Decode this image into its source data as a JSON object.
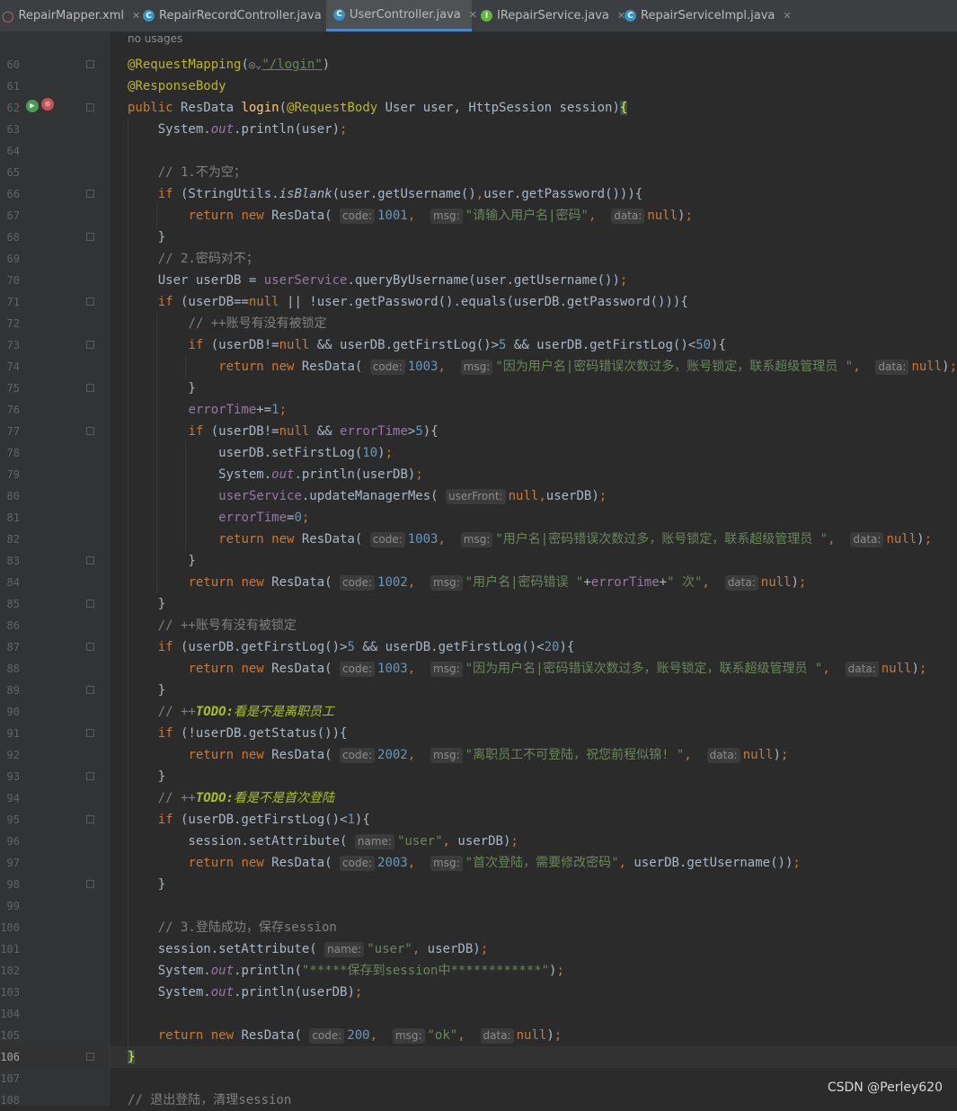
{
  "tabs": [
    {
      "label": "RepairMapper.xml",
      "icon": "xml-file-icon",
      "active": false
    },
    {
      "label": "RepairRecordController.java",
      "icon": "class-icon",
      "active": false
    },
    {
      "label": "UserController.java",
      "icon": "class-icon",
      "active": true
    },
    {
      "label": "IRepairService.java",
      "icon": "interface-icon",
      "active": false
    },
    {
      "label": "RepairServiceImpl.java",
      "icon": "class-icon",
      "active": false
    }
  ],
  "editor": {
    "usages_hint": "no usages",
    "current_line": 106,
    "line_numbers": [
      "60",
      "61",
      "62",
      "63",
      "64",
      "65",
      "66",
      "67",
      "68",
      "69",
      "70",
      "71",
      "72",
      "73",
      "74",
      "75",
      "76",
      "77",
      "78",
      "79",
      "80",
      "81",
      "82",
      "83",
      "84",
      "85",
      "86",
      "87",
      "88",
      "89",
      "90",
      "91",
      "92",
      "93",
      "94",
      "95",
      "96",
      "97",
      "98",
      "99",
      "100",
      "101",
      "102",
      "103",
      "104",
      "105",
      "106",
      "107",
      "108"
    ],
    "strings": {
      "login_path": "\"/login\"",
      "msg_empty": "\"请输入用户名|密码\"",
      "msg_locked_a": "\"因为用户名|密码错误次数过多，账号锁定，联系超级管理员 \"",
      "msg_locked_b": "\"用户名|密码错误次数过多，账号锁定，联系超级管理员 \"",
      "msg_wrong_a": "\"用户名|密码错误 \"",
      "msg_wrong_b": "\" 次\"",
      "msg_locked_c": "\"因为用户名|密码错误次数过多，账号锁定，联系超级管理员 \"",
      "msg_resigned": "\"离职员工不可登陆，祝您前程似锦! \"",
      "user_a": "\"user\"",
      "msg_first": "\"首次登陆，需要修改密码\"",
      "user_b": "\"user\"",
      "saved_session": "\"*****保存到session中************\"",
      "ok": "\"ok\""
    },
    "comments": {
      "c65": "// 1.不为空；",
      "c69": "// 2.密码对不；",
      "c72": "// ++账号有没有被锁定",
      "c86": "// ++账号有没有被锁定",
      "c90_prefix": "// ++",
      "c90_todo": "TODO:",
      "c90_text": "看是不是离职员工",
      "c94_prefix": "// ++",
      "c94_todo": "TODO:",
      "c94_text": "看是不是首次登陆",
      "c100": "// 3.登陆成功，保存session",
      "c108": "// 退出登陆，清理session"
    },
    "numbers": {
      "n1001": "1001",
      "n1003a": "1003",
      "n5a": "5",
      "n50": "50",
      "n1": "1",
      "n5b": "5",
      "n10": "10",
      "n0": "0",
      "n1003b": "1003",
      "n1002": "1002",
      "n5c": "5",
      "n20": "20",
      "n1003c": "1003",
      "n2002": "2002",
      "n1c": "1",
      "n2003": "2003",
      "n200": "200"
    },
    "hints": {
      "code": "code:",
      "msg": "msg:",
      "data": "data:",
      "userFront": "userFront:",
      "name": "name:"
    }
  },
  "watermark": "CSDN @Perley620"
}
